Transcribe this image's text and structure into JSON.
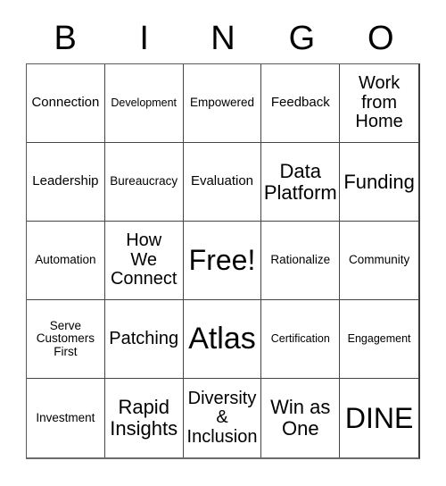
{
  "card": {
    "title": "BINGO",
    "header_letters": [
      "B",
      "I",
      "N",
      "G",
      "O"
    ],
    "free_space_label": "Free!",
    "colors": {
      "background": "#ffffff",
      "text": "#000000",
      "grid_line": "#454545",
      "grid_outer": "#3d3d3d"
    },
    "rows": [
      [
        {
          "text": "Connection",
          "size": "sz-md"
        },
        {
          "text": "Development",
          "size": "sz-xs"
        },
        {
          "text": "Empowered",
          "size": "sz-sm"
        },
        {
          "text": "Feedback",
          "size": "sz-md"
        },
        {
          "text": "Work\nfrom\nHome",
          "size": "sz-lg"
        }
      ],
      [
        {
          "text": "Leadership",
          "size": "sz-md"
        },
        {
          "text": "Bureaucracy",
          "size": "sz-sm"
        },
        {
          "text": "Evaluation",
          "size": "sz-md"
        },
        {
          "text": "Data\nPlatform",
          "size": "sz-xl"
        },
        {
          "text": "Funding",
          "size": "sz-xl"
        }
      ],
      [
        {
          "text": "Automation",
          "size": "sz-sm"
        },
        {
          "text": "How\nWe\nConnect",
          "size": "sz-lg"
        },
        {
          "text": "Free!",
          "size": "sz-xxl"
        },
        {
          "text": "Rationalize",
          "size": "sz-sm"
        },
        {
          "text": "Community",
          "size": "sz-sm"
        }
      ],
      [
        {
          "text": "Serve\nCustomers\nFirst",
          "size": "sz-sm"
        },
        {
          "text": "Patching",
          "size": "sz-lg"
        },
        {
          "text": "Atlas",
          "size": "sz-huge"
        },
        {
          "text": "Certification",
          "size": "sz-xs"
        },
        {
          "text": "Engagement",
          "size": "sz-xs"
        }
      ],
      [
        {
          "text": "Investment",
          "size": "sz-sm"
        },
        {
          "text": "Rapid\nInsights",
          "size": "sz-xl"
        },
        {
          "text": "Diversity\n&\nInclusion",
          "size": "sz-lg"
        },
        {
          "text": "Win as\nOne",
          "size": "sz-xl"
        },
        {
          "text": "DINE",
          "size": "sz-xxl"
        }
      ]
    ]
  }
}
